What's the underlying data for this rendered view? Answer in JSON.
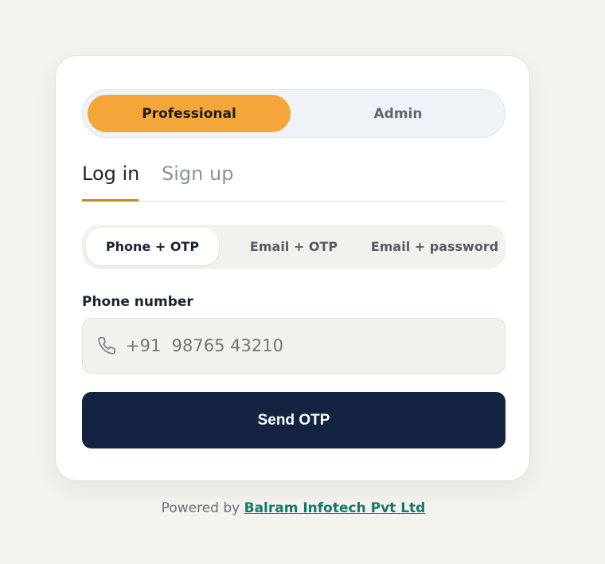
{
  "role_toggle": {
    "options": [
      {
        "label": "Professional",
        "selected": true
      },
      {
        "label": "Admin",
        "selected": false
      }
    ],
    "accent": "#f4a63b"
  },
  "auth_tabs": {
    "options": [
      {
        "label": "Log in",
        "selected": true
      },
      {
        "label": "Sign up",
        "selected": false
      }
    ]
  },
  "login_methods": {
    "options": [
      {
        "label": "Phone + OTP",
        "selected": true
      },
      {
        "label": "Email + OTP",
        "selected": false
      },
      {
        "label": "Email + password",
        "selected": false
      }
    ]
  },
  "phone_field": {
    "label": "Phone number",
    "placeholder": "+91  98765 43210",
    "icon": "phone-icon"
  },
  "submit": {
    "label": "Send OTP",
    "color": "#132340"
  },
  "footer": {
    "prefix": "Powered by",
    "link_text": "Balram Infotech Pvt Ltd",
    "link_color": "#13796b"
  }
}
